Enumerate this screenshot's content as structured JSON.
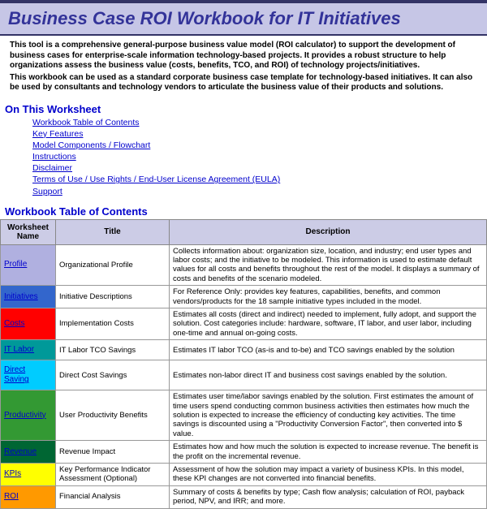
{
  "header": {
    "title": "Business Case ROI Workbook for IT Initiatives"
  },
  "intro": {
    "p1": "This tool is a comprehensive general-purpose business value model (ROI calculator) to support the development of business cases for enterprise-scale information technology-based projects.  It provides a robust structure to help organizations assess the business value (costs, benefits, TCO, and ROI) of technology projects/initiatives.",
    "p2": "This workbook can be used as a standard corporate business case template for technology-based initiatives.  It can also be used by consultants and technology vendors to articulate the business value of their products and solutions."
  },
  "nav": {
    "heading": "On This Worksheet",
    "items": [
      "Workbook Table of Contents",
      "Key Features",
      "Model Components / Flowchart",
      "Instructions",
      "Disclaimer",
      "Terms of Use / Use Rights / End-User License Agreement (EULA)",
      "Support"
    ]
  },
  "toc": {
    "heading": "Workbook Table of Contents",
    "cols": {
      "c1": "Worksheet Name",
      "c2": "Title",
      "c3": "Description"
    },
    "rows": [
      {
        "name": "Profile",
        "title": "Organizational Profile",
        "desc": "Collects information about: organization size, location, and industry; end user types and labor costs; and the initiative to be modeled.  This information is used to estimate default values for all costs and benefits throughout the rest of the model.  It displays a summary of costs and benefits of the scenario modeled."
      },
      {
        "name": "Initiatives",
        "title": "Initiative Descriptions",
        "desc": "For Reference Only:  provides key features, capabilities, benefits, and common vendors/products for the 18 sample initiative types included in the model."
      },
      {
        "name": "Costs",
        "title": "Implementation Costs",
        "desc": "Estimates all costs (direct and indirect) needed to implement, fully adopt, and support the solution.  Cost categories include: hardware, software, IT labor, and user labor, including one-time and annual on-going costs."
      },
      {
        "name": "IT Labor",
        "title": "IT Labor TCO Savings",
        "desc": "Estimates IT labor TCO (as-is and to-be) and TCO savings enabled by the solution"
      },
      {
        "name": "Direct Saving",
        "title": "Direct Cost Savings",
        "desc": "Estimates non-labor direct IT and business cost savings enabled by the solution."
      },
      {
        "name": "Productivity",
        "title": "User Productivity Benefits",
        "desc": "Estimates user time/labor savings enabled by the solution.  First estimates the amount of time users spend conducting common business activities then estimates how much the solution is expected to increase the efficiency of conducting key activities.  The time savings is discounted using a \"Productivity Conversion Factor\", then converted into $ value."
      },
      {
        "name": "Revenue",
        "title": "Revenue Impact",
        "desc": "Estimates how and how much the solution is expected to increase revenue.  The benefit is the profit on the incremental revenue."
      },
      {
        "name": "KPIs",
        "title": "Key Performance Indicator Assessment (Optional)",
        "desc": "Assessment of how the solution may impact a variety of business KPIs.  In this model, these KPI changes are not converted into financial benefits."
      },
      {
        "name": "ROI",
        "title": "Financial Analysis",
        "desc": "Summary of costs & benefits by type; Cash flow analysis; calculation of ROI, payback period, NPV, and IRR; and more."
      }
    ]
  }
}
